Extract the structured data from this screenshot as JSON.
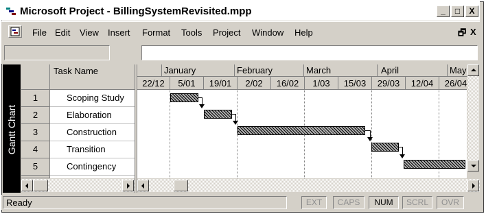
{
  "window": {
    "title": "Microsoft Project - BillingSystemRevisited.mpp",
    "icon": "ms-project-app-icon",
    "controls": [
      "_",
      "□",
      "X"
    ]
  },
  "menubar": {
    "doc_icon": "document-control-icon",
    "items": [
      "File",
      "Edit",
      "View",
      "Insert",
      "Format",
      "Tools",
      "Project",
      "Window",
      "Help"
    ],
    "mdi_controls": [
      "🗗",
      "X"
    ]
  },
  "entry_bar": {
    "value": ""
  },
  "view_bar": {
    "label": "Gantt Chart"
  },
  "task_table": {
    "columns": [
      "",
      "Task Name"
    ],
    "rows": [
      {
        "id": "1",
        "name": "Scoping Study"
      },
      {
        "id": "2",
        "name": "Elaboration"
      },
      {
        "id": "3",
        "name": "Construction"
      },
      {
        "id": "4",
        "name": "Transition"
      },
      {
        "id": "5",
        "name": "Contingency"
      }
    ]
  },
  "timescale": {
    "months": [
      "January",
      "February",
      "March",
      "April",
      "May"
    ],
    "weeks": [
      "22/12",
      "5/01",
      "19/01",
      "2/02",
      "16/02",
      "1/03",
      "15/03",
      "29/03",
      "12/04",
      "26/04"
    ]
  },
  "gantt_bars": [
    {
      "task": "Scoping Study",
      "start": "5/01",
      "end": "19/01"
    },
    {
      "task": "Elaboration",
      "start": "19/01",
      "end": "2/02"
    },
    {
      "task": "Construction",
      "start": "2/02",
      "end": "29/03"
    },
    {
      "task": "Transition",
      "start": "29/03",
      "end": "12/04"
    },
    {
      "task": "Contingency",
      "start": "12/04",
      "end": "12/05"
    }
  ],
  "colors": {
    "bar_fill": "#b0b0b0",
    "chrome": "#d4d0c8",
    "view_bar": "#000000"
  },
  "statusbar": {
    "text": "Ready",
    "indicators": [
      {
        "label": "EXT",
        "active": false
      },
      {
        "label": "CAPS",
        "active": false
      },
      {
        "label": "NUM",
        "active": true
      },
      {
        "label": "SCRL",
        "active": false
      },
      {
        "label": "OVR",
        "active": false
      }
    ]
  }
}
